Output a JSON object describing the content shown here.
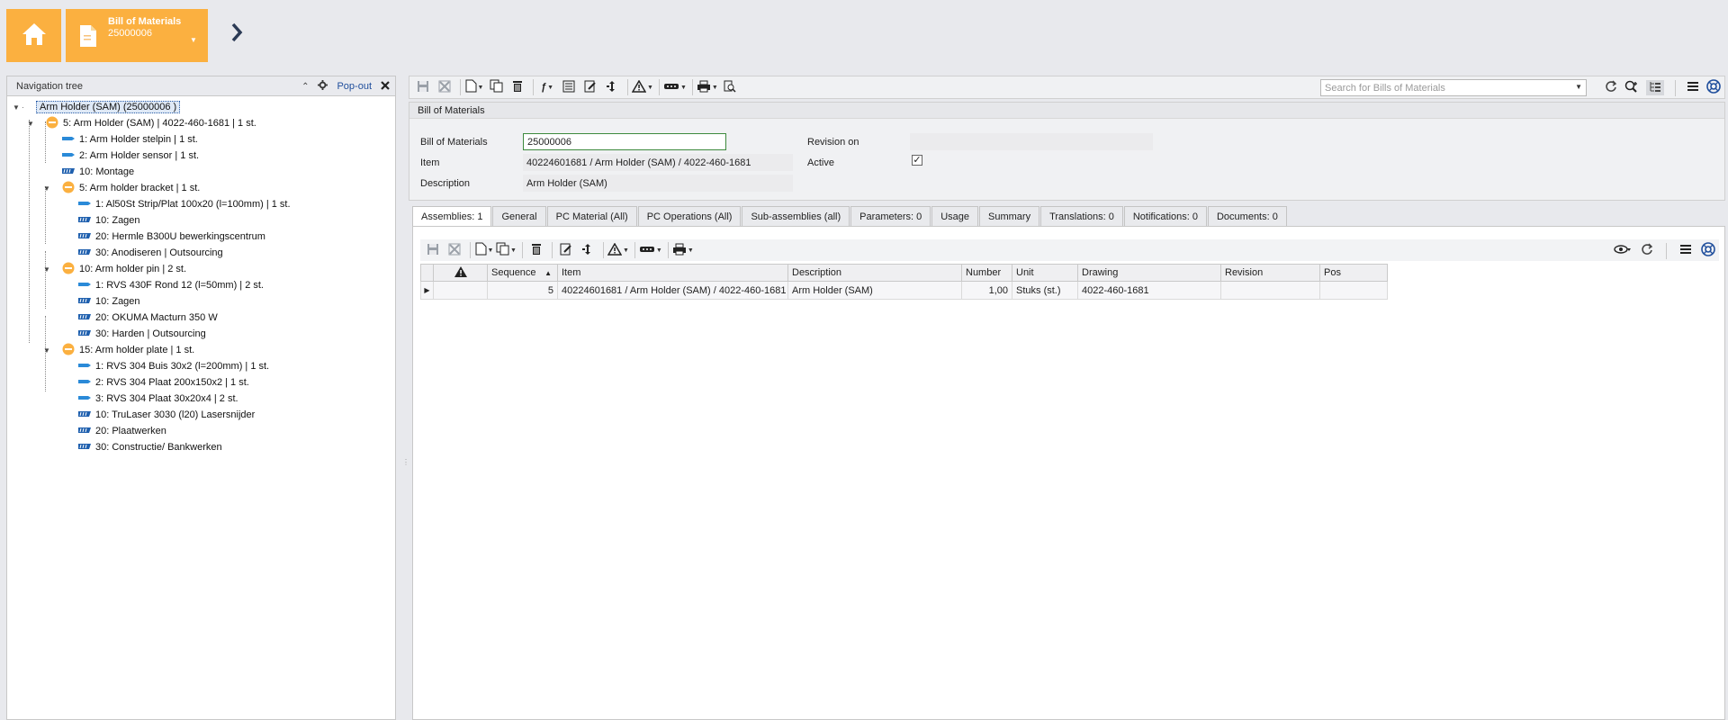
{
  "topbar": {
    "tab_title": "Bill of Materials",
    "tab_subtitle": "25000006"
  },
  "nav": {
    "title": "Navigation tree",
    "popout_label": "Pop-out",
    "tree": [
      {
        "label": "Arm Holder (SAM) (25000006 )",
        "type": "root"
      },
      {
        "label": "5: Arm Holder (SAM) | 4022-460-1681 | 1 st.",
        "type": "assembly"
      },
      {
        "label": "1: Arm Holder stelpin | 1 st.",
        "type": "material"
      },
      {
        "label": "2: Arm Holder sensor | 1 st.",
        "type": "material"
      },
      {
        "label": "10: Montage",
        "type": "operation"
      },
      {
        "label": "5: Arm holder bracket | 1 st.",
        "type": "assembly"
      },
      {
        "label": "1: Al50St Strip/Plat 100x20 (l=100mm) | 1 st.",
        "type": "material"
      },
      {
        "label": "10: Zagen",
        "type": "operation"
      },
      {
        "label": "20: Hermle B300U bewerkingscentrum",
        "type": "operation"
      },
      {
        "label": "30: Anodiseren | Outsourcing",
        "type": "operation"
      },
      {
        "label": "10: Arm holder pin | 2 st.",
        "type": "assembly"
      },
      {
        "label": "1: RVS 430F Rond 12 (l=50mm) | 2 st.",
        "type": "material"
      },
      {
        "label": "10: Zagen",
        "type": "operation"
      },
      {
        "label": "20: OKUMA Macturn 350 W",
        "type": "operation"
      },
      {
        "label": "30: Harden | Outsourcing",
        "type": "operation"
      },
      {
        "label": "15: Arm holder plate | 1 st.",
        "type": "assembly"
      },
      {
        "label": "1: RVS 304 Buis 30x2 (l=200mm) | 1 st.",
        "type": "material"
      },
      {
        "label": "2: RVS 304 Plaat 200x150x2 | 1 st.",
        "type": "material"
      },
      {
        "label": "3: RVS 304 Plaat 30x20x4 | 2 st.",
        "type": "material"
      },
      {
        "label": "10: TruLaser 3030 (l20) Lasersnijder",
        "type": "operation"
      },
      {
        "label": "20: Plaatwerken",
        "type": "operation"
      },
      {
        "label": "30: Constructie/ Bankwerken",
        "type": "operation"
      }
    ]
  },
  "search": {
    "placeholder": "Search for Bills of Materials"
  },
  "bom": {
    "header": "Bill of Materials",
    "bom_label": "Bill of Materials",
    "bom_value": "25000006",
    "item_label": "Item",
    "item_value": "40224601681 / Arm Holder (SAM) / 4022-460-1681",
    "description_label": "Description",
    "description_value": "Arm Holder (SAM)",
    "revision_label": "Revision on",
    "revision_value": "",
    "active_label": "Active",
    "active_checked": true
  },
  "tabs": [
    {
      "label": "Assemblies: 1",
      "active": true
    },
    {
      "label": "General"
    },
    {
      "label": "PC Material (All)"
    },
    {
      "label": "PC Operations (All)"
    },
    {
      "label": "Sub-assemblies (all)"
    },
    {
      "label": "Parameters: 0"
    },
    {
      "label": "Usage"
    },
    {
      "label": "Summary"
    },
    {
      "label": "Translations: 0"
    },
    {
      "label": "Notifications: 0"
    },
    {
      "label": "Documents: 0"
    }
  ],
  "grid": {
    "columns": [
      "",
      "",
      "Sequence",
      "Item",
      "Description",
      "Number",
      "Unit",
      "Drawing",
      "Revision",
      "Pos"
    ],
    "rows": [
      [
        "",
        "",
        "5",
        "40224601681 / Arm Holder (SAM) / 4022-460-1681",
        "Arm Holder (SAM)",
        "1,00",
        "Stuks (st.)",
        "4022-460-1681",
        "",
        ""
      ]
    ]
  },
  "colors": {
    "accent": "#fbb040",
    "link": "#1f4e9c",
    "material_icon": "#2a8ad8",
    "operation_icon": "#1e5fae"
  }
}
